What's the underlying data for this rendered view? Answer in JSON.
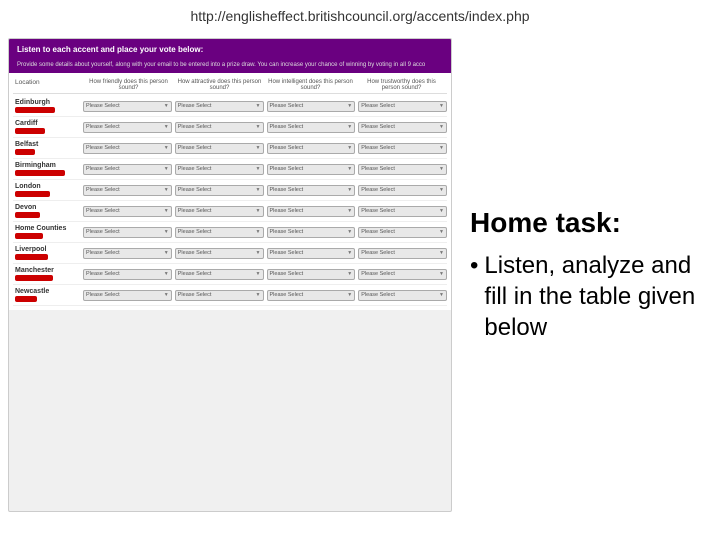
{
  "url": "http://englisheffect.britishcouncil.org/accents/index.php",
  "website": {
    "header": "Listen to each accent and place your vote below:",
    "subtext": "Provide some details about yourself, along with your email to be entered into a prize draw. You can increase your chance of winning by voting in all 9 acco",
    "columns": {
      "location": "Location",
      "q1": "How friendly does this person sound?",
      "q2": "How attractive does this person sound?",
      "q3": "How intelligent does this person sound?",
      "q4": "How trustworthy does this person sound?"
    },
    "rows": [
      {
        "name": "Edinburgh",
        "barWidth": 40
      },
      {
        "name": "Cardiff",
        "barWidth": 30
      },
      {
        "name": "Belfast",
        "barWidth": 20
      },
      {
        "name": "Birmingham",
        "barWidth": 50
      },
      {
        "name": "London",
        "barWidth": 35
      },
      {
        "name": "Devon",
        "barWidth": 25
      },
      {
        "name": "Home Counties",
        "barWidth": 28
      },
      {
        "name": "Liverpool",
        "barWidth": 33
      },
      {
        "name": "Manchester",
        "barWidth": 38
      },
      {
        "name": "Newcastle",
        "barWidth": 22
      }
    ],
    "selectPlaceholder": "Please Select"
  },
  "task": {
    "title": "Home task:",
    "bullet_marker": "•",
    "bullet_text": "Listen, analyze and fill in the table given below"
  }
}
